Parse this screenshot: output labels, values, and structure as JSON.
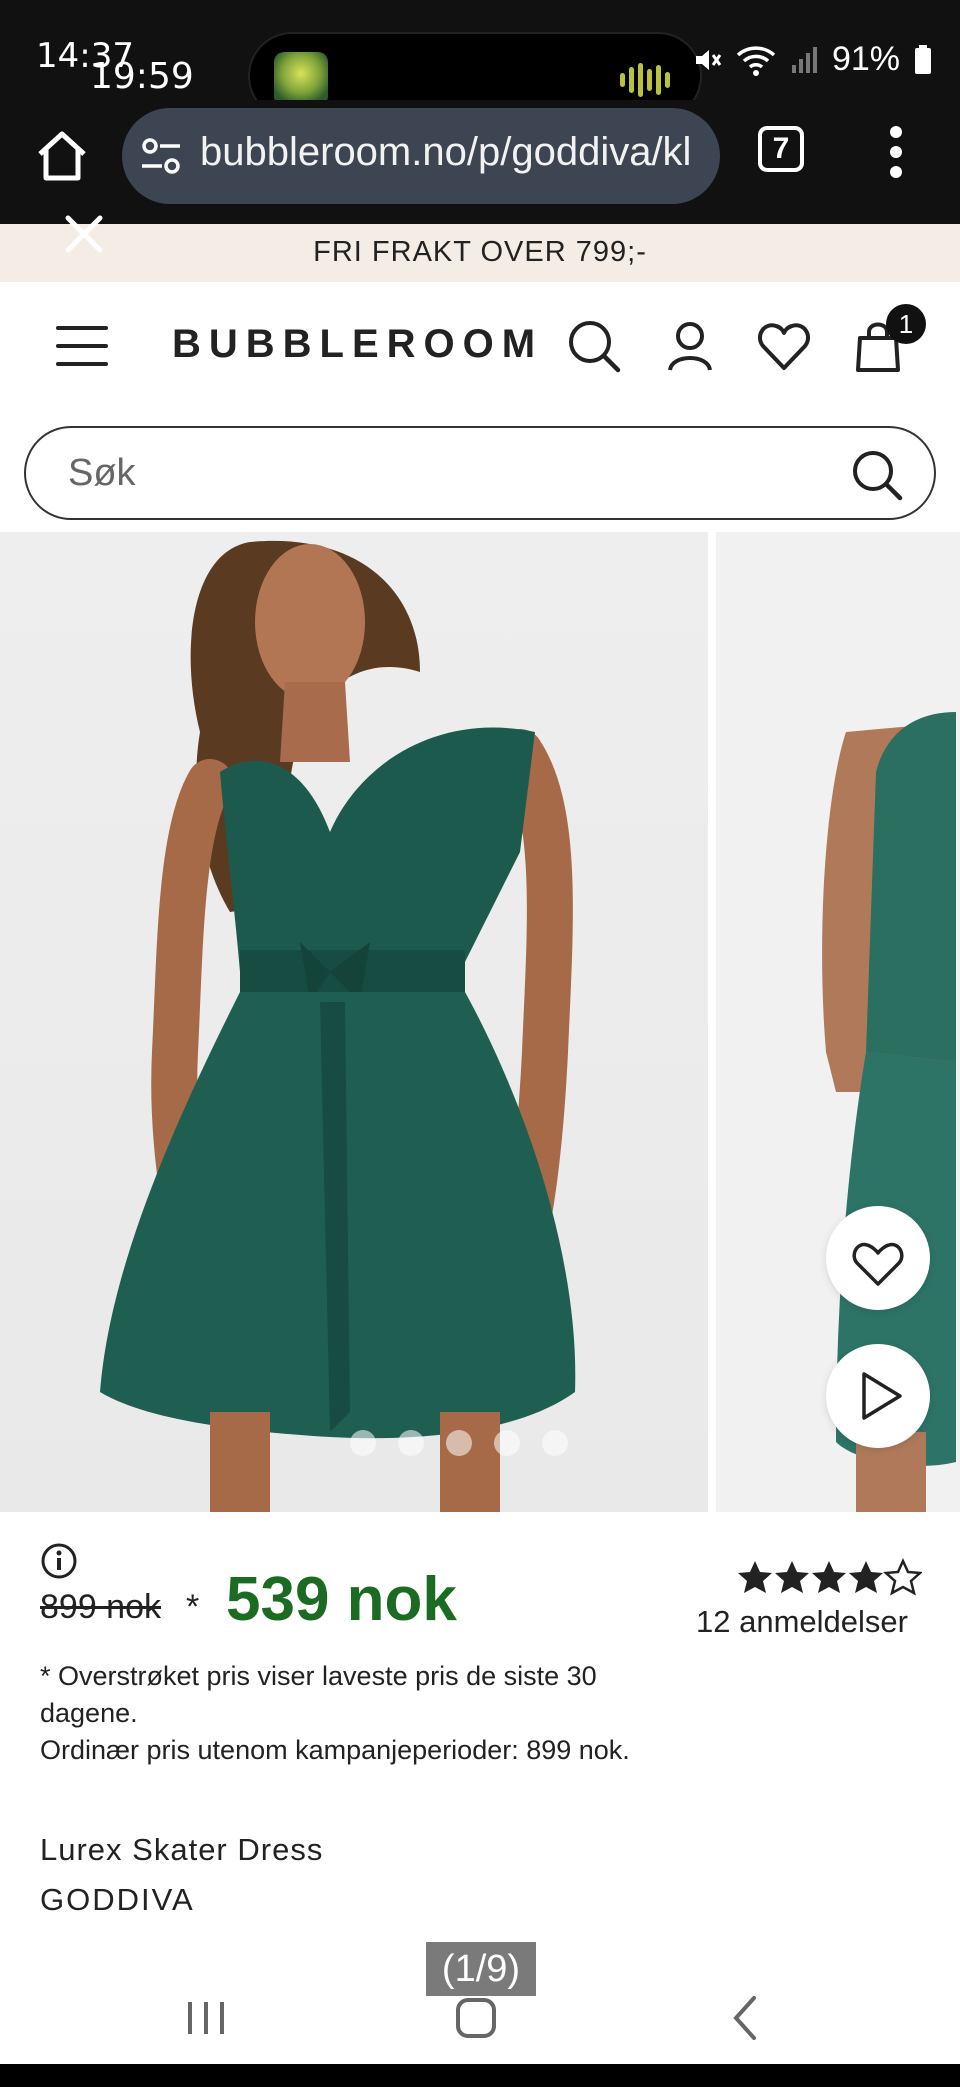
{
  "status_bar": {
    "time_primary": "14:37",
    "time_secondary": "19:59",
    "battery": "91%",
    "wave_color": "#b9c23a"
  },
  "browser": {
    "url": "bubbleroom.no/p/goddiva/kl",
    "tab_count": "7",
    "icons": [
      "home-icon",
      "tune-icon",
      "tabs-icon",
      "more-icon"
    ]
  },
  "promo_banner": {
    "text": "FRI FRAKT OVER 799;-"
  },
  "header": {
    "logo": "BUBBLEROOM",
    "cart_count": "1",
    "icons": [
      "menu-icon",
      "search-icon",
      "account-icon",
      "wishlist-icon",
      "cart-icon"
    ]
  },
  "search": {
    "placeholder": "Søk"
  },
  "gallery": {
    "dot_count": 5,
    "dress_color": "#1d5a4e"
  },
  "product": {
    "old_price": "899 nok",
    "old_price_marker": "*",
    "price": "539 nok",
    "price_color": "#1b6b23",
    "rating": 4.5,
    "reviews": "12 anmeldelser",
    "price_note_1": "* Overstrøket pris viser laveste pris de siste 30 dagene.",
    "price_note_2": "Ordinær pris utenom kampanjeperioder: 899 nok.",
    "name": "Lurex Skater Dress",
    "brand": "GODDIVA"
  },
  "overlay": {
    "counter": "(1/9)"
  }
}
